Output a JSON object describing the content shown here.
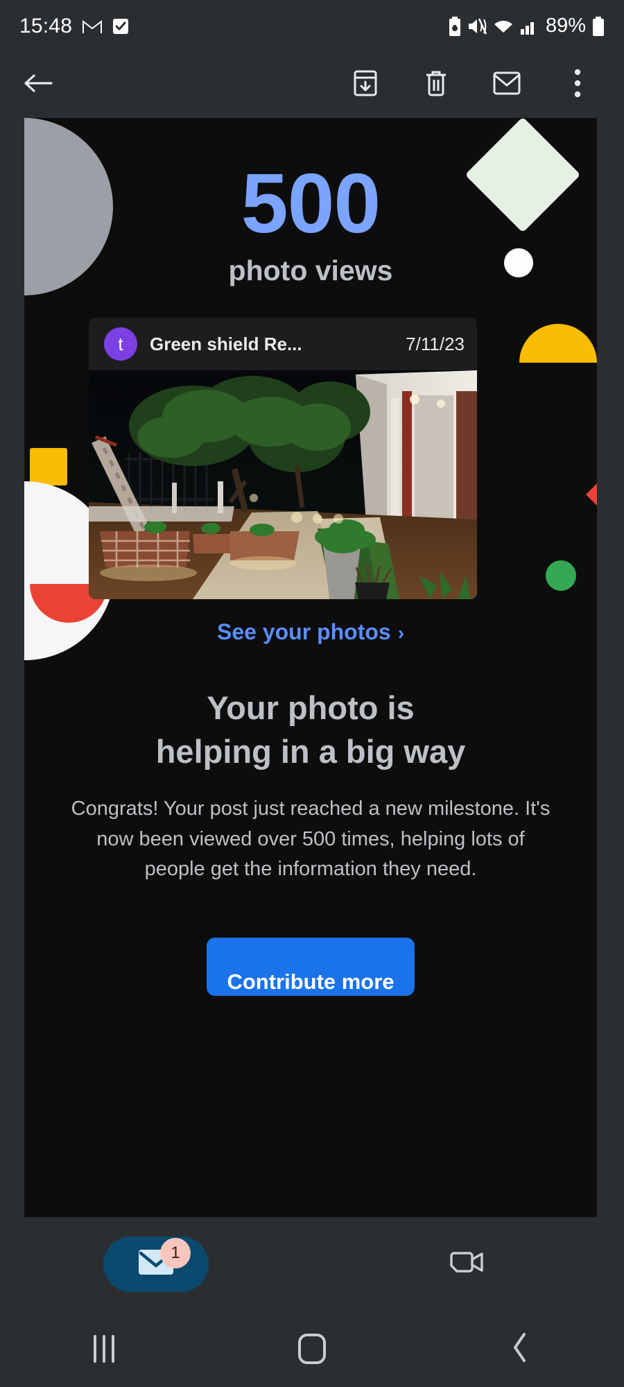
{
  "status_bar": {
    "time": "15:48",
    "battery_percent": "89%",
    "icons": [
      "gmail-icon",
      "checkbox-icon",
      "battery-saver-icon",
      "vibrate-icon",
      "wifi-icon",
      "signal-icon",
      "battery-icon"
    ]
  },
  "toolbar": {
    "back_label": "back-arrow",
    "archive_label": "archive",
    "delete_label": "delete",
    "unread_label": "mark-unread",
    "more_label": "more-options"
  },
  "email": {
    "hero_number": "500",
    "hero_subtitle": "photo views",
    "photo_card": {
      "avatar_letter": "t",
      "sender": "Green shield Re...",
      "date": "7/11/23",
      "photo_alt": "night-garden-walkway-photo"
    },
    "see_photos_link": "See your photos",
    "see_photos_chevron": "›",
    "headline_line1": "Your photo is",
    "headline_line2": "helping in a big way",
    "body": "Congrats! Your post just reached a new milestone. It's now been viewed over 500 times, helping lots of people get the information they need.",
    "cta_label": "Contribute more",
    "colors": {
      "hero_number": "#7ba4ff",
      "link": "#5b8dfb",
      "cta_background": "#1a73e8",
      "avatar": "#7b3fe4",
      "card_background": "#0d0d0d"
    }
  },
  "bottom_nav": {
    "mail_label": "mail-tab",
    "mail_badge": "1",
    "meet_label": "meet-tab"
  },
  "android_nav": {
    "recents_label": "recents",
    "home_label": "home",
    "back_label": "back"
  }
}
